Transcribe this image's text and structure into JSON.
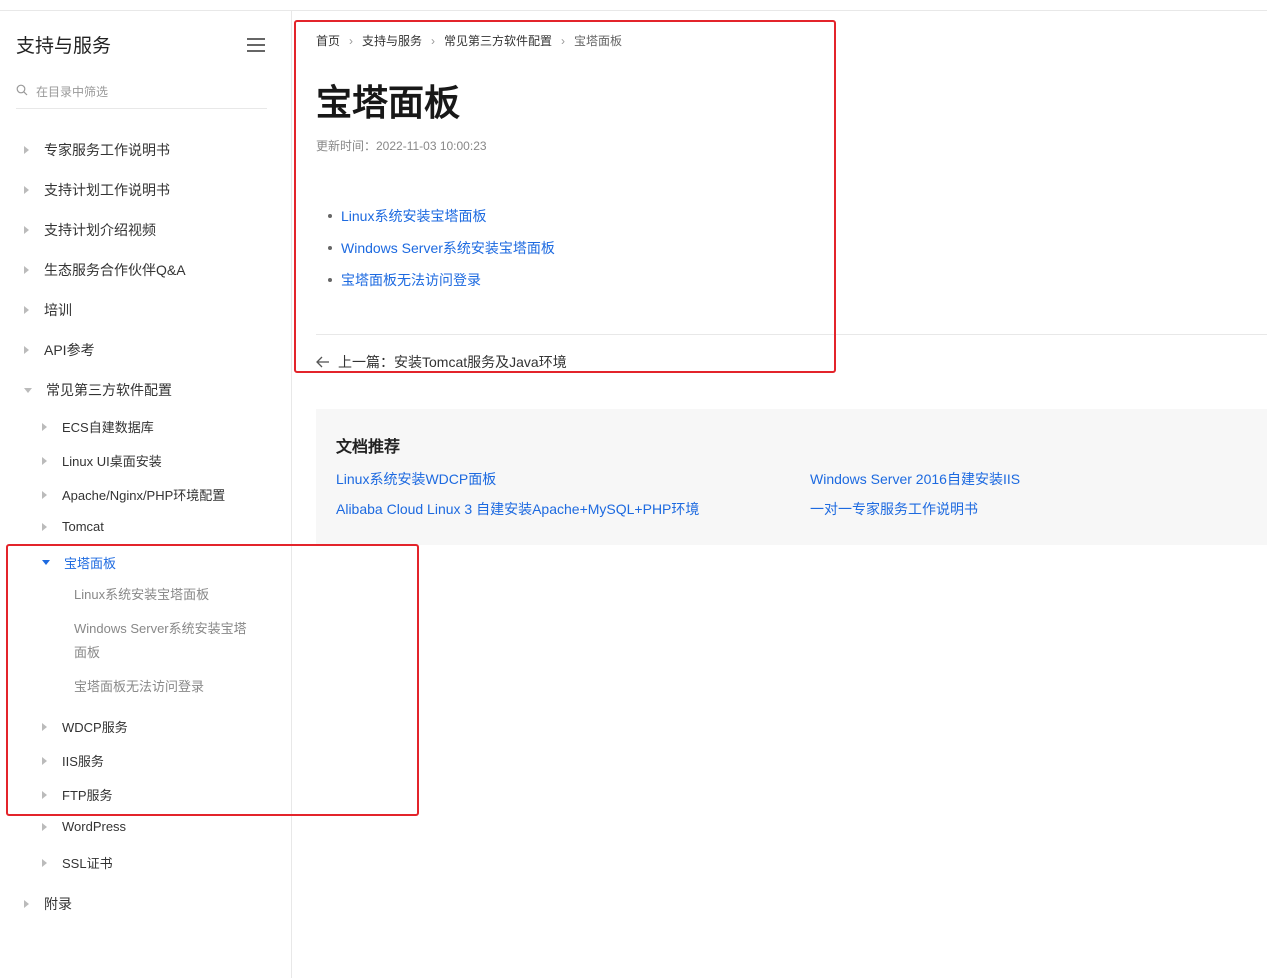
{
  "sidebar": {
    "title": "支持与服务",
    "filter_placeholder": "在目录中筛选",
    "items": [
      {
        "label": "专家服务工作说明书"
      },
      {
        "label": "支持计划工作说明书"
      },
      {
        "label": "支持计划介绍视频"
      },
      {
        "label": "生态服务合作伙伴Q&A"
      },
      {
        "label": "培训"
      },
      {
        "label": "API参考"
      },
      {
        "label": "常见第三方软件配置"
      },
      {
        "label": "附录"
      }
    ],
    "sub_items": [
      {
        "label": "ECS自建数据库"
      },
      {
        "label": "Linux UI桌面安装"
      },
      {
        "label": "Apache/Nginx/PHP环境配置"
      },
      {
        "label": "Tomcat"
      },
      {
        "label": "宝塔面板"
      },
      {
        "label": "WDCP服务"
      },
      {
        "label": "IIS服务"
      },
      {
        "label": "FTP服务"
      },
      {
        "label": "WordPress"
      },
      {
        "label": "SSL证书"
      }
    ],
    "leaf_items": [
      {
        "label": "Linux系统安装宝塔面板"
      },
      {
        "label": "Windows Server系统安装宝塔面板"
      },
      {
        "label": "宝塔面板无法访问登录"
      }
    ]
  },
  "breadcrumb": [
    "首页",
    "支持与服务",
    "常见第三方软件配置",
    "宝塔面板"
  ],
  "main": {
    "title": "宝塔面板",
    "updated": "更新时间：2022-11-03 10:00:23",
    "links": [
      "Linux系统安装宝塔面板",
      "Windows Server系统安装宝塔面板",
      "宝塔面板无法访问登录"
    ],
    "prev_label": "上一篇：安装Tomcat服务及Java环境"
  },
  "recommend": {
    "title": "文档推荐",
    "links": [
      "Linux系统安装WDCP面板",
      "Windows Server 2016自建安装IIS",
      "Alibaba Cloud Linux 3 自建安装Apache+MySQL+PHP环境",
      "一对一专家服务工作说明书"
    ]
  },
  "colors": {
    "accent": "#1d6ae0",
    "annotation": "#e3242b"
  }
}
